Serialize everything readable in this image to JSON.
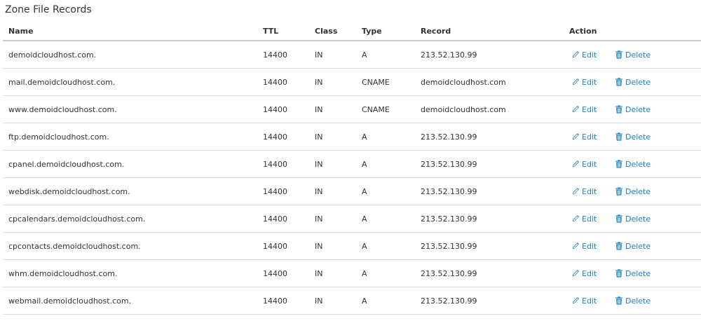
{
  "page": {
    "title": "Zone File Records"
  },
  "table": {
    "headers": [
      "Name",
      "TTL",
      "Class",
      "Type",
      "Record",
      "Action"
    ],
    "edit_label": "Edit",
    "delete_label": "Delete",
    "rows": [
      {
        "name": "demoidcloudhost.com.",
        "ttl": "14400",
        "class": "IN",
        "type": "A",
        "record": "213.52.130.99"
      },
      {
        "name": "mail.demoidcloudhost.com.",
        "ttl": "14400",
        "class": "IN",
        "type": "CNAME",
        "record": "demoidcloudhost.com"
      },
      {
        "name": "www.demoidcloudhost.com.",
        "ttl": "14400",
        "class": "IN",
        "type": "CNAME",
        "record": "demoidcloudhost.com"
      },
      {
        "name": "ftp.demoidcloudhost.com.",
        "ttl": "14400",
        "class": "IN",
        "type": "A",
        "record": "213.52.130.99"
      },
      {
        "name": "cpanel.demoidcloudhost.com.",
        "ttl": "14400",
        "class": "IN",
        "type": "A",
        "record": "213.52.130.99"
      },
      {
        "name": "webdisk.demoidcloudhost.com.",
        "ttl": "14400",
        "class": "IN",
        "type": "A",
        "record": "213.52.130.99"
      },
      {
        "name": "cpcalendars.demoidcloudhost.com.",
        "ttl": "14400",
        "class": "IN",
        "type": "A",
        "record": "213.52.130.99"
      },
      {
        "name": "cpcontacts.demoidcloudhost.com.",
        "ttl": "14400",
        "class": "IN",
        "type": "A",
        "record": "213.52.130.99"
      },
      {
        "name": "whm.demoidcloudhost.com.",
        "ttl": "14400",
        "class": "IN",
        "type": "A",
        "record": "213.52.130.99"
      },
      {
        "name": "webmail.demoidcloudhost.com.",
        "ttl": "14400",
        "class": "IN",
        "type": "A",
        "record": "213.52.130.99"
      }
    ]
  },
  "colors": {
    "link": "#1a83c4",
    "text": "#333333",
    "row_border": "#dddddd",
    "header_border": "#cccccc"
  },
  "icons": {
    "edit": "pencil-icon",
    "delete": "trash-icon"
  }
}
